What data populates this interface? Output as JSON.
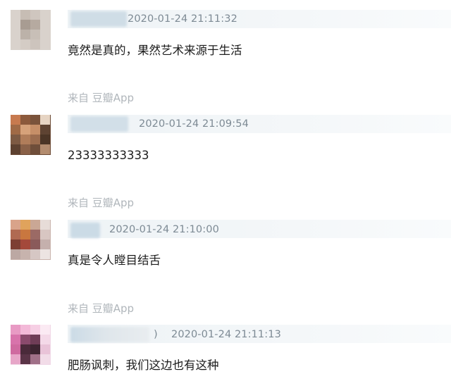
{
  "comments": [
    {
      "timestamp": "2020-01-24 21:11:32",
      "text": "竟然是真的，果然艺术来源于生活",
      "source": "来自 豆瓣App"
    },
    {
      "timestamp": "2020-01-24 21:09:54",
      "text": "23333333333",
      "source": "来自 豆瓣App"
    },
    {
      "timestamp": "2020-01-24 21:10:00",
      "text": "真是令人瞠目结舌",
      "source": "来自 豆瓣App"
    },
    {
      "paren": ")",
      "timestamp": "2020-01-24 21:11:13",
      "text": "肥肠讽刺，我们这边也有这种"
    }
  ],
  "colors": {
    "timestamp": "#7d8a94",
    "comment_text": "#1c1c1c",
    "source_text": "#b0b6bb",
    "meta_bar": "#eef3f6"
  }
}
